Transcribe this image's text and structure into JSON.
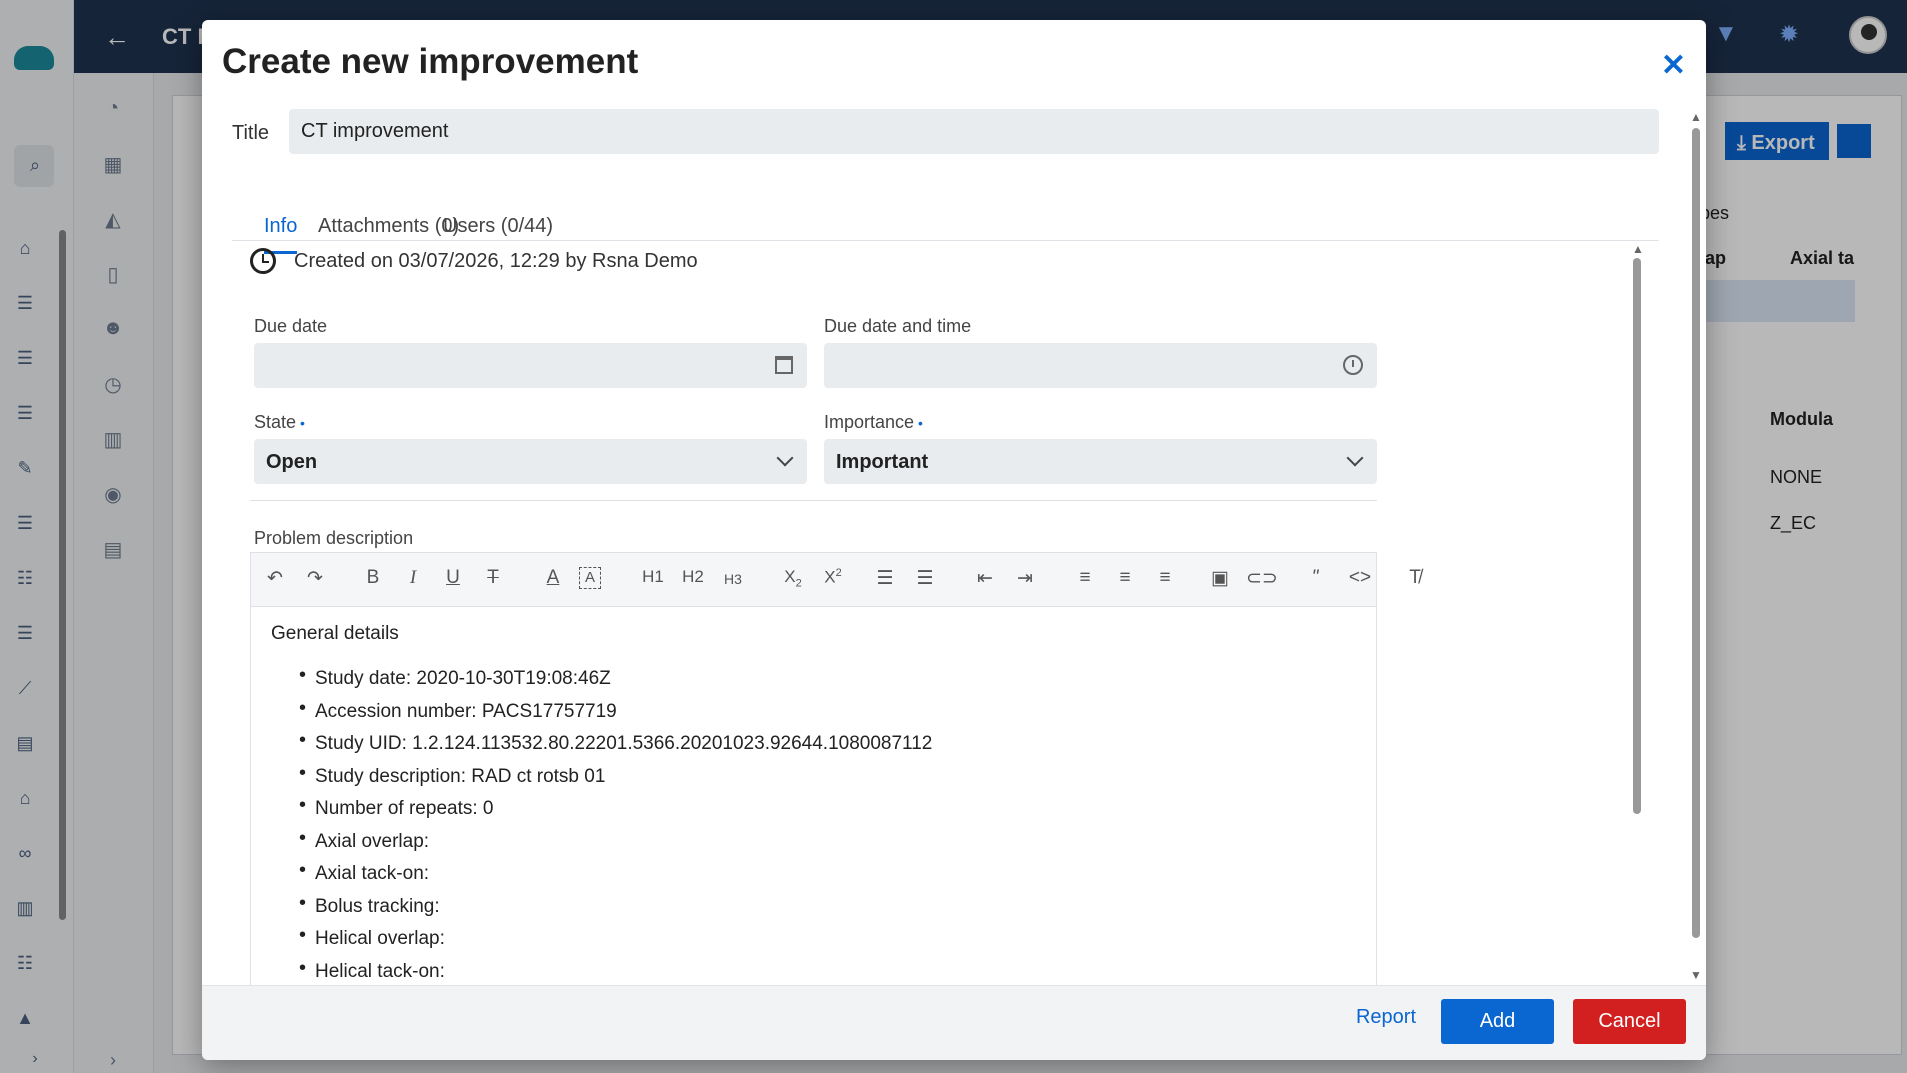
{
  "background": {
    "page_title": "CT F",
    "export_label": "Export",
    "col_partial_1": "pes",
    "col_partial_2": "lap",
    "col_partial_3": "Axial ta",
    "col_partial_4": "Modula",
    "cell_1": "NONE",
    "cell_2": "Z_EC"
  },
  "dialog": {
    "title": "Create new improvement",
    "title_label": "Title",
    "title_value": "CT improvement",
    "tabs": [
      {
        "label": "Info",
        "active": true
      },
      {
        "label": "Attachments (0)",
        "active": false
      },
      {
        "label": "Users (0/44)",
        "active": false
      }
    ],
    "created_text": "Created on 03/07/2026, 12:29 by Rsna Demo",
    "due_date_label": "Due date",
    "due_datetime_label": "Due date and time",
    "state_label": "State",
    "state_value": "Open",
    "importance_label": "Importance",
    "importance_value": "Important",
    "required_marker": "•",
    "problem_label": "Problem description",
    "toolbar": [
      "undo",
      "redo",
      "B",
      "I",
      "U",
      "T",
      "A",
      "A",
      "H1",
      "H2",
      "H3",
      "X2",
      "X2",
      "ol",
      "ul",
      "outdent",
      "indent",
      "left",
      "center",
      "right",
      "image",
      "link",
      "quote",
      "code",
      "clear"
    ],
    "editor_heading": "General details",
    "editor_items": [
      "Study date: 2020-10-30T19:08:46Z",
      "Accession number: PACS17757719",
      "Study UID: 1.2.124.113532.80.22201.5366.20201023.92644.1080087112",
      "Study description: RAD ct rotsb 01",
      "Number of repeats: 0",
      "Axial overlap:",
      "Axial tack-on:",
      "Bolus tracking:",
      "Helical overlap:",
      "Helical tack-on:"
    ],
    "buttons": {
      "report": "Report",
      "add": "Add",
      "cancel": "Cancel"
    }
  }
}
